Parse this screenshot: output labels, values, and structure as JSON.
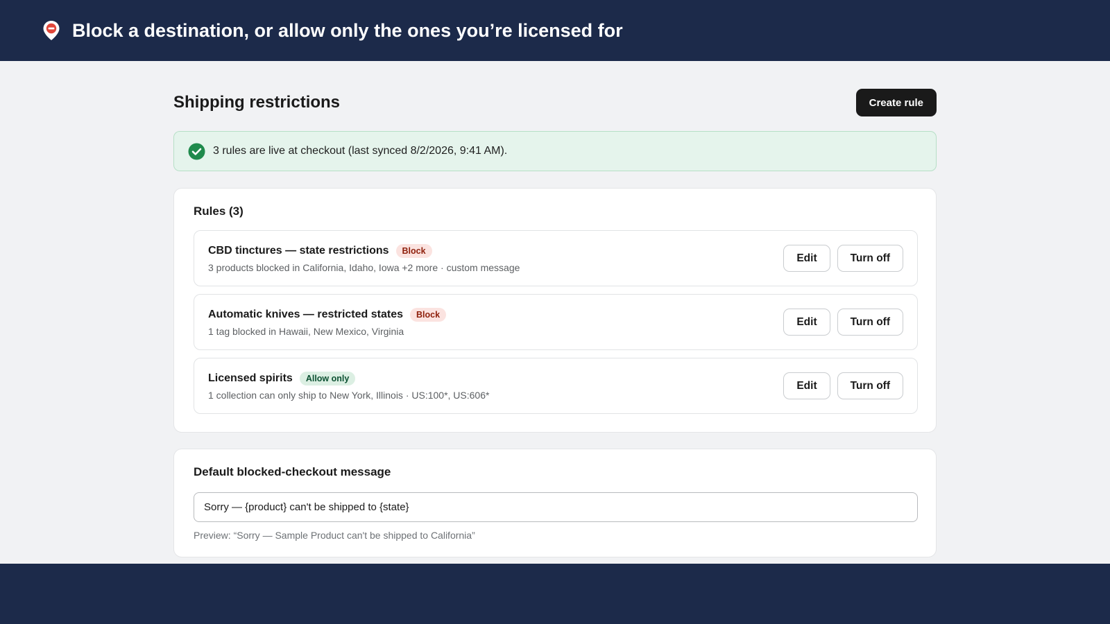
{
  "header": {
    "title": "Block a destination, or allow only the ones you’re licensed for",
    "icon": "location-block-pin-icon"
  },
  "page": {
    "title": "Shipping restrictions",
    "create_button": "Create rule"
  },
  "banner": {
    "icon": "check-circle-icon",
    "text": "3 rules are live at checkout (last synced 8/2/2026, 9:41 AM)."
  },
  "rules_card": {
    "title": "Rules (3)",
    "rules": [
      {
        "name": "CBD tinctures — state restrictions",
        "badge": "Block",
        "description": "3 products blocked in California, Idaho, Iowa +2 more · custom message",
        "edit_label": "Edit",
        "toggle_label": "Turn off"
      },
      {
        "name": "Automatic knives — restricted states",
        "badge": "Block",
        "description": "1 tag blocked in Hawaii, New Mexico, Virginia",
        "edit_label": "Edit",
        "toggle_label": "Turn off"
      },
      {
        "name": "Licensed spirits",
        "badge": "Allow only",
        "description": "1 collection can only ship to New York, Illinois · US:100*, US:606*",
        "edit_label": "Edit",
        "toggle_label": "Turn off"
      }
    ]
  },
  "default_message": {
    "title": "Default blocked-checkout message",
    "value": "Sorry — {product} can't be shipped to {state}",
    "preview": "Preview: “Sorry — Sample Product can't be shipped to California”"
  },
  "colors": {
    "header_bg": "#1c2a4a",
    "page_bg": "#f1f2f4",
    "primary_button": "#1a1a1a",
    "success": "#1f8a4c",
    "block_badge_bg": "#fbe3e0",
    "allow_badge_bg": "#dcefe3"
  }
}
